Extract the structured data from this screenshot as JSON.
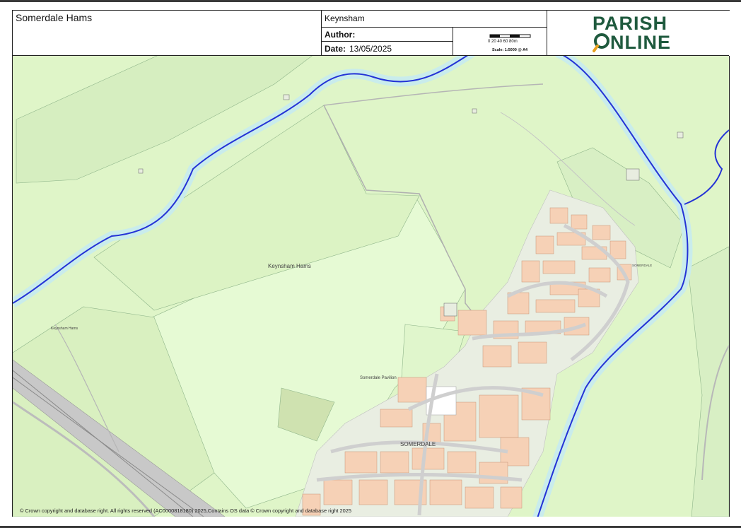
{
  "header": {
    "title": "Somerdale Hams",
    "location": "Keynsham",
    "author_label": "Author:",
    "date_label": "Date:",
    "date_value": "13/05/2025",
    "scale_ticks": "0   20   40   60 80m",
    "scale_text": "Scale: 1:5000 @ A4"
  },
  "logo": {
    "line1": "PARISH",
    "line2": "NLINE",
    "color": "#1f5a3e",
    "accent": "#e8a11f"
  },
  "map": {
    "labels": {
      "keynsham_hams": "Keynsham Hams",
      "keynsham_hams_small": "Keynsham Hams",
      "somerdale_pavilion": "Somerdale Pavilion",
      "somerdale": "SOMERDALE",
      "somerdale_small": "SOMERDALE"
    },
    "colors": {
      "land": "#dff5c8",
      "field_light": "#e6fad4",
      "river": "#c9ecec",
      "river_line": "#2332d6",
      "buildings": "#f6d1b6",
      "roads": "#cfcfcf",
      "rail": "#b9b9b9"
    },
    "copyright": "© Crown copyright and database right. All rights reserved (AC0000818180) 2025,Contains OS data © Crown copyright and database right 2025"
  }
}
